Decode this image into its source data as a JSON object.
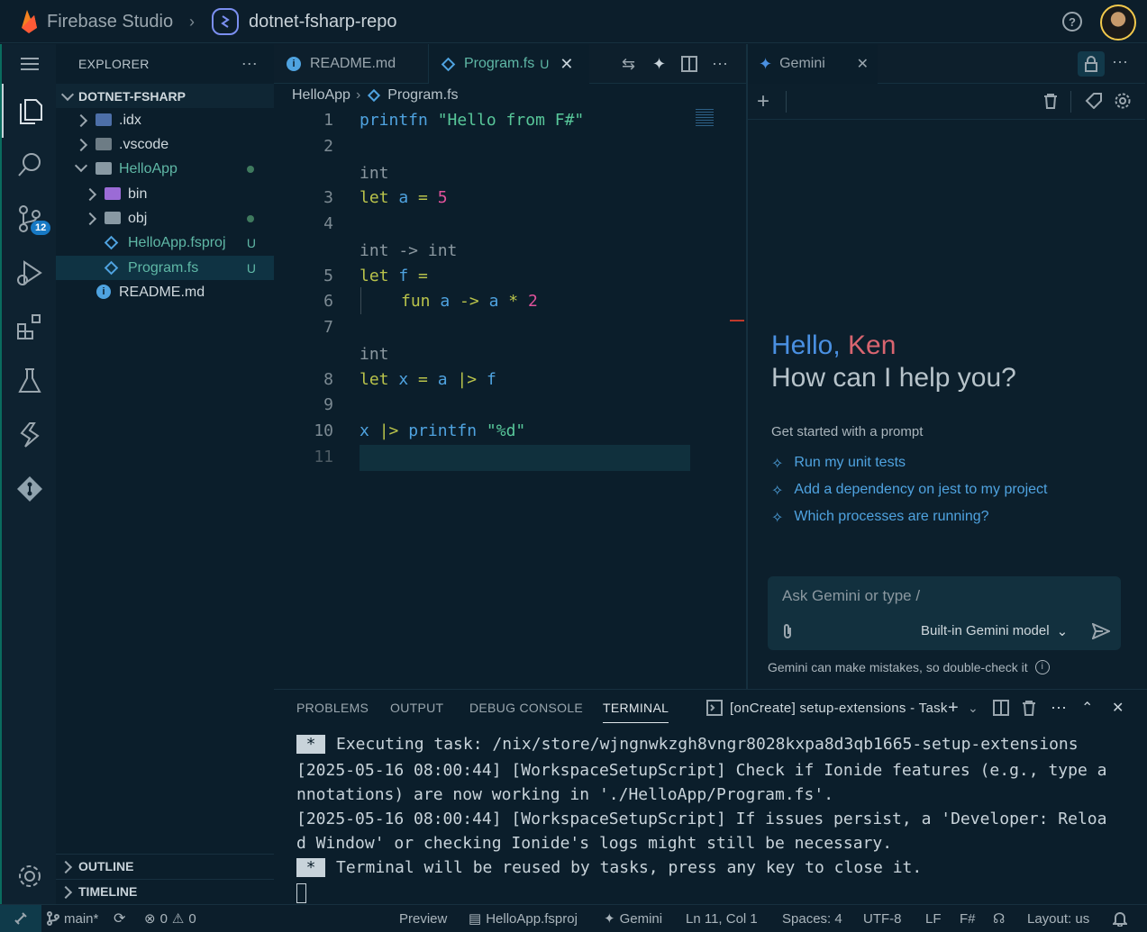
{
  "topbar": {
    "brand": "Firebase Studio",
    "repo": "dotnet-fsharp-repo",
    "help": "?"
  },
  "activity": {
    "scm_badge": "12"
  },
  "explorer": {
    "title": "EXPLORER",
    "root": "DOTNET-FSHARP",
    "items": [
      {
        "label": ".idx"
      },
      {
        "label": ".vscode"
      },
      {
        "label": "HelloApp"
      },
      {
        "label": "bin"
      },
      {
        "label": "obj"
      },
      {
        "label": "HelloApp.fsproj",
        "badge": "U"
      },
      {
        "label": "Program.fs",
        "badge": "U"
      },
      {
        "label": "README.md"
      }
    ],
    "outline": "OUTLINE",
    "timeline": "TIMELINE"
  },
  "tabs": [
    {
      "label": "README.md"
    },
    {
      "label": "Program.fs",
      "badge": "U"
    }
  ],
  "breadcrumb": {
    "folder": "HelloApp",
    "file": "Program.fs"
  },
  "code": {
    "line_numbers": [
      "1",
      "2",
      "3",
      "4",
      "5",
      "6",
      "7",
      "8",
      "9",
      "10",
      "11"
    ],
    "l1_fn": "printfn",
    "l1_str": "\"Hello from F#\"",
    "hint1": "int",
    "l3_kw": "let",
    "l3_id": "a",
    "l3_eq": "=",
    "l3_num": "5",
    "hint2": "int -> int",
    "l5_kw": "let",
    "l5_id": "f",
    "l5_eq": "=",
    "l6_kw": "fun",
    "l6_a": "a",
    "l6_arrow": "->",
    "l6_a2": "a",
    "l6_mul": "*",
    "l6_num": "2",
    "hint3": "int",
    "l8_kw": "let",
    "l8_x": "x",
    "l8_eq": "=",
    "l8_a": "a",
    "l8_pipe": "|>",
    "l8_f": "f",
    "l10_x": "x",
    "l10_pipe": "|>",
    "l10_fn": "printfn",
    "l10_str": "\"%d\""
  },
  "gemini": {
    "tab": "Gemini",
    "hello": "Hello,",
    "name": "Ken",
    "question": "How can I help you?",
    "get_started": "Get started with a prompt",
    "prompts": [
      "Run my unit tests",
      "Add a dependency on jest to my project",
      "Which processes are running?"
    ],
    "input_placeholder": "Ask Gemini or type /",
    "model": "Built-in Gemini model",
    "disclaimer": "Gemini can make mistakes, so double-check it"
  },
  "panel": {
    "tabs": [
      "PROBLEMS",
      "OUTPUT",
      "DEBUG CONSOLE",
      "TERMINAL"
    ],
    "task": "[onCreate] setup-extensions - Task",
    "star": "*",
    "lines": [
      "Executing task: /nix/store/wjngnwkzgh8vngr8028kxpa8d3qb1665-setup-extensions",
      "[2025-05-16 08:00:44] [WorkspaceSetupScript] Check if Ionide features (e.g., type a",
      "nnotations) are now working in './HelloApp/Program.fs'.",
      "[2025-05-16 08:00:44] [WorkspaceSetupScript] If issues persist, a 'Developer: Reloa",
      "d Window' or checking Ionide's logs might still be necessary.",
      "Terminal will be reused by tasks, press any key to close it."
    ]
  },
  "status": {
    "branch": "main*",
    "errors": "0",
    "warnings": "0",
    "preview": "Preview",
    "project": "HelloApp.fsproj",
    "gemini": "Gemini",
    "position": "Ln 11, Col 1",
    "spaces": "Spaces: 4",
    "encoding": "UTF-8",
    "eol": "LF",
    "lang": "F#",
    "layout": "Layout: us"
  },
  "colors": {
    "accent": "#4fa3e0",
    "gemini_blue": "#4a90e2",
    "gemini_pink": "#d96570",
    "keyword": "#b9c34b",
    "string": "#58c79a",
    "number": "#e0529b"
  }
}
